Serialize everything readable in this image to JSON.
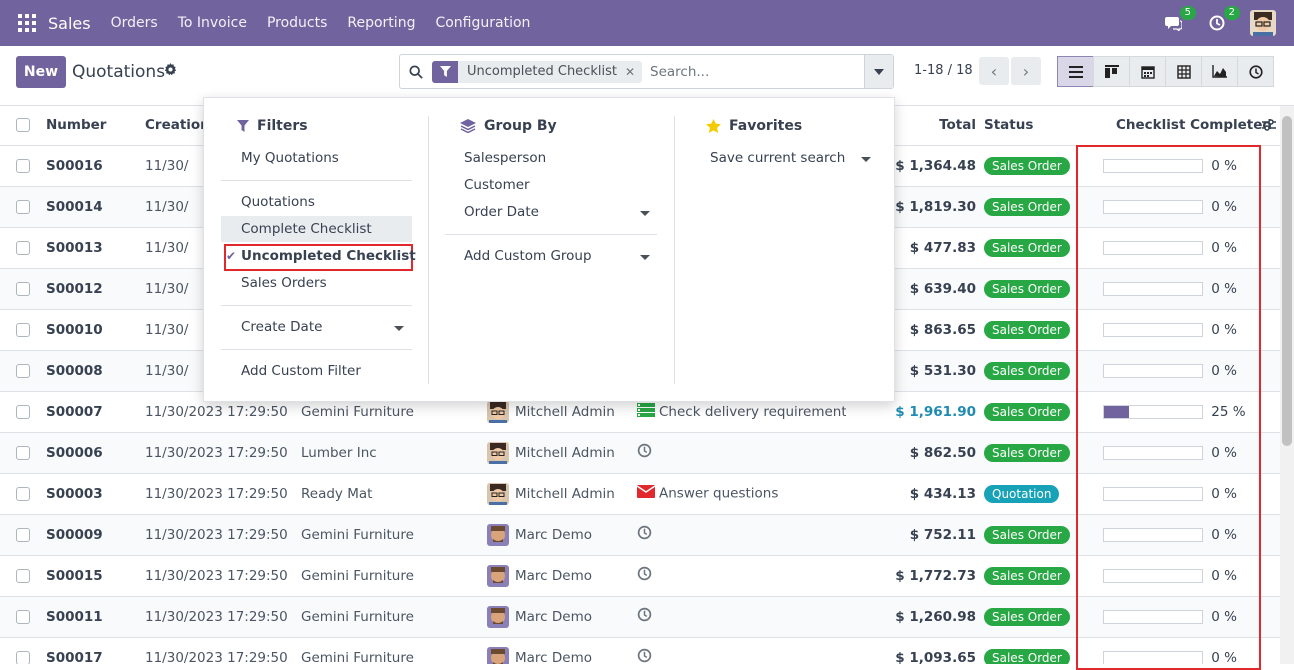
{
  "navbar": {
    "brand": "Sales",
    "menu": [
      "Orders",
      "To Invoice",
      "Products",
      "Reporting",
      "Configuration"
    ],
    "chat_count": "5",
    "activity_count": "2"
  },
  "control_panel": {
    "new_label": "New",
    "title": "Quotations",
    "facet_label": "Uncompleted Checklist",
    "search_placeholder": "Search...",
    "pager": "1-18 / 18"
  },
  "columns": {
    "number": "Number",
    "creation": "Creation",
    "total": "Total",
    "status": "Status",
    "checklist": "Checklist Completed"
  },
  "rows": [
    {
      "number": "S00016",
      "date": "11/30/",
      "customer": "",
      "salesperson": "",
      "activity": "",
      "total": "$ 1,364.48",
      "status": "Sales Order",
      "progress": 0,
      "progress_label": "0 %"
    },
    {
      "number": "S00014",
      "date": "11/30/",
      "customer": "",
      "salesperson": "",
      "activity": "",
      "total": "$ 1,819.30",
      "status": "Sales Order",
      "progress": 0,
      "progress_label": "0 %"
    },
    {
      "number": "S00013",
      "date": "11/30/",
      "customer": "",
      "salesperson": "",
      "activity": "",
      "total": "$ 477.83",
      "status": "Sales Order",
      "progress": 0,
      "progress_label": "0 %"
    },
    {
      "number": "S00012",
      "date": "11/30/",
      "customer": "",
      "salesperson": "",
      "activity": "",
      "total": "$ 639.40",
      "status": "Sales Order",
      "progress": 0,
      "progress_label": "0 %"
    },
    {
      "number": "S00010",
      "date": "11/30/",
      "customer": "",
      "salesperson": "",
      "activity": "",
      "total": "$ 863.65",
      "status": "Sales Order",
      "progress": 0,
      "progress_label": "0 %"
    },
    {
      "number": "S00008",
      "date": "11/30/",
      "customer": "",
      "salesperson": "",
      "activity": "",
      "total": "$ 531.30",
      "status": "Sales Order",
      "progress": 0,
      "progress_label": "0 %"
    },
    {
      "number": "S00007",
      "date": "11/30/2023 17:29:50",
      "customer": "Gemini Furniture",
      "salesperson": "Mitchell Admin",
      "activity": "Check delivery requirements",
      "total": "$ 1,961.90",
      "status": "Sales Order",
      "progress": 25,
      "progress_label": "25 %"
    },
    {
      "number": "S00006",
      "date": "11/30/2023 17:29:50",
      "customer": "Lumber Inc",
      "salesperson": "Mitchell Admin",
      "activity": "",
      "total": "$ 862.50",
      "status": "Sales Order",
      "progress": 0,
      "progress_label": "0 %"
    },
    {
      "number": "S00003",
      "date": "11/30/2023 17:29:50",
      "customer": "Ready Mat",
      "salesperson": "Mitchell Admin",
      "activity": "Answer questions",
      "total": "$ 434.13",
      "status": "Quotation",
      "progress": 0,
      "progress_label": "0 %"
    },
    {
      "number": "S00009",
      "date": "11/30/2023 17:29:50",
      "customer": "Gemini Furniture",
      "salesperson": "Marc Demo",
      "activity": "",
      "total": "$ 752.11",
      "status": "Sales Order",
      "progress": 0,
      "progress_label": "0 %"
    },
    {
      "number": "S00015",
      "date": "11/30/2023 17:29:50",
      "customer": "Gemini Furniture",
      "salesperson": "Marc Demo",
      "activity": "",
      "total": "$ 1,772.73",
      "status": "Sales Order",
      "progress": 0,
      "progress_label": "0 %"
    },
    {
      "number": "S00011",
      "date": "11/30/2023 17:29:50",
      "customer": "Gemini Furniture",
      "salesperson": "Marc Demo",
      "activity": "",
      "total": "$ 1,260.98",
      "status": "Sales Order",
      "progress": 0,
      "progress_label": "0 %"
    },
    {
      "number": "S00017",
      "date": "11/30/2023 17:29:50",
      "customer": "Gemini Furniture",
      "salesperson": "Marc Demo",
      "activity": "",
      "total": "$ 1,093.65",
      "status": "Sales Order",
      "progress": 0,
      "progress_label": "0 %"
    }
  ],
  "dropdown": {
    "filters": {
      "title": "Filters",
      "items": [
        "My Quotations",
        "Quotations",
        "Complete Checklist",
        "Uncompleted Checklist",
        "Sales Orders",
        "Create Date",
        "Add Custom Filter"
      ]
    },
    "group_by": {
      "title": "Group By",
      "items": [
        "Salesperson",
        "Customer",
        "Order Date",
        "Add Custom Group"
      ]
    },
    "favorites": {
      "title": "Favorites",
      "items": [
        "Save current search"
      ]
    }
  },
  "colors": {
    "brand": "#71639e",
    "sales_order": "#28a745",
    "quotation": "#17a2b8",
    "highlight": "#e0282d"
  }
}
